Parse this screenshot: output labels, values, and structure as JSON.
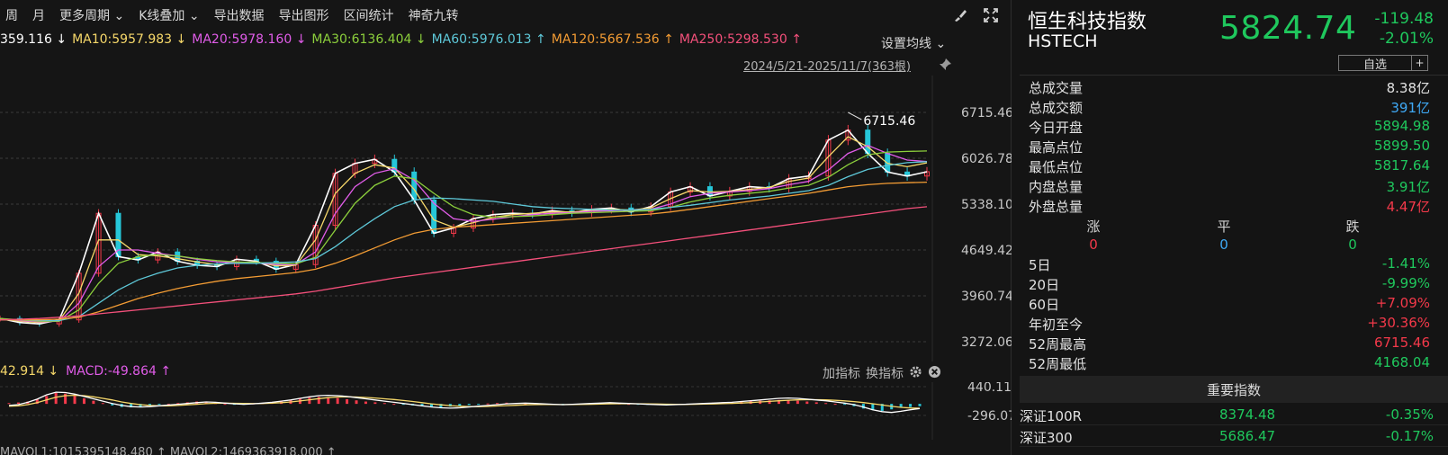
{
  "toolbar": {
    "items": [
      "周",
      "月",
      "更多周期 ⌄",
      "K线叠加 ⌄",
      "导出数据",
      "导出图形",
      "区间统计",
      "神奇九转"
    ]
  },
  "ma_legend": [
    {
      "text": "359.116 ↓",
      "color": "#ffffff"
    },
    {
      "text": "MA10:5957.983 ↓",
      "color": "#f6d86a"
    },
    {
      "text": "MA20:5978.160 ↓",
      "color": "#e05ce8"
    },
    {
      "text": "MA30:6136.404 ↓",
      "color": "#8ccf3c"
    },
    {
      "text": "MA60:5976.013 ↑",
      "color": "#5ec8d8"
    },
    {
      "text": "MA120:5667.536 ↑",
      "color": "#f39c34"
    },
    {
      "text": "MA250:5298.530 ↑",
      "color": "#f4507b"
    }
  ],
  "ma_setting_label": "设置均线 ⌄",
  "date_range": "2024/5/21-2025/11/7(363根)",
  "macd_legend": [
    {
      "text": "42.914 ↓",
      "color": "#f6d86a"
    },
    {
      "text": "MACD:-49.864 ↑",
      "color": "#e05ce8"
    }
  ],
  "indicator_buttons": {
    "add": "加指标",
    "switch": "换指标"
  },
  "chart_data": [
    {
      "type": "line",
      "title": "",
      "y_ticks": [
        "6715.46",
        "6026.78",
        "5338.10",
        "4649.42",
        "3960.74",
        "3272.06"
      ],
      "ylim": [
        3200,
        6800
      ],
      "peak_annotation": "6715.46",
      "grid": true,
      "series": [
        {
          "name": "",
          "color": "#ffffff",
          "values": [
            3620,
            3560,
            3540,
            3600,
            4300,
            5200,
            4550,
            4500,
            4620,
            4480,
            4420,
            4400,
            4510,
            4480,
            4360,
            4430,
            5020,
            5800,
            5950,
            6010,
            5820,
            5400,
            4900,
            4980,
            5120,
            5180,
            5200,
            5190,
            5240,
            5210,
            5260,
            5280,
            5220,
            5300,
            5520,
            5600,
            5460,
            5530,
            5600,
            5580,
            5720,
            5760,
            6300,
            6450,
            6100,
            5820,
            5760,
            5824.74
          ]
        },
        {
          "name": "",
          "color": "#f6d86a",
          "values": [
            3620,
            3580,
            3560,
            3590,
            4000,
            4800,
            4800,
            4580,
            4560,
            4520,
            4470,
            4430,
            4460,
            4470,
            4410,
            4420,
            4800,
            5500,
            5800,
            5930,
            5880,
            5560,
            5100,
            4990,
            5060,
            5140,
            5180,
            5200,
            5220,
            5220,
            5240,
            5260,
            5250,
            5280,
            5420,
            5540,
            5520,
            5530,
            5560,
            5590,
            5680,
            5730,
            6050,
            6350,
            6200,
            5950,
            5900,
            5957.98
          ]
        },
        {
          "name": "",
          "color": "#e05ce8",
          "values": [
            3620,
            3590,
            3570,
            3580,
            3850,
            4400,
            4650,
            4650,
            4600,
            4560,
            4510,
            4470,
            4460,
            4460,
            4430,
            4430,
            4620,
            5200,
            5600,
            5800,
            5870,
            5700,
            5350,
            5120,
            5080,
            5110,
            5150,
            5180,
            5200,
            5210,
            5230,
            5240,
            5250,
            5260,
            5340,
            5450,
            5500,
            5520,
            5540,
            5570,
            5630,
            5680,
            5850,
            6100,
            6220,
            6100,
            6000,
            5978.16
          ]
        },
        {
          "name": "",
          "color": "#8ccf3c",
          "values": [
            3620,
            3600,
            3580,
            3580,
            3750,
            4150,
            4450,
            4550,
            4580,
            4560,
            4520,
            4490,
            4470,
            4460,
            4450,
            4440,
            4540,
            4950,
            5350,
            5620,
            5760,
            5720,
            5500,
            5300,
            5180,
            5140,
            5150,
            5160,
            5180,
            5200,
            5210,
            5220,
            5230,
            5240,
            5290,
            5370,
            5430,
            5470,
            5500,
            5530,
            5580,
            5620,
            5740,
            5930,
            6080,
            6120,
            6130,
            6136.4
          ]
        },
        {
          "name": "",
          "color": "#5ec8d8",
          "values": [
            3600,
            3600,
            3590,
            3590,
            3650,
            3850,
            4050,
            4200,
            4300,
            4380,
            4420,
            4440,
            4450,
            4450,
            4460,
            4470,
            4520,
            4700,
            4920,
            5120,
            5300,
            5400,
            5430,
            5420,
            5400,
            5380,
            5340,
            5300,
            5280,
            5270,
            5260,
            5250,
            5250,
            5260,
            5290,
            5320,
            5360,
            5400,
            5430,
            5460,
            5500,
            5540,
            5620,
            5750,
            5860,
            5920,
            5960,
            5976.01
          ]
        },
        {
          "name": "",
          "color": "#f39c34",
          "values": [
            3600,
            3600,
            3600,
            3610,
            3640,
            3720,
            3820,
            3920,
            4000,
            4070,
            4130,
            4180,
            4220,
            4250,
            4280,
            4310,
            4360,
            4450,
            4560,
            4680,
            4800,
            4900,
            4960,
            4990,
            5010,
            5030,
            5050,
            5070,
            5090,
            5110,
            5130,
            5150,
            5170,
            5190,
            5220,
            5260,
            5300,
            5340,
            5380,
            5420,
            5460,
            5500,
            5550,
            5600,
            5630,
            5650,
            5660,
            5667.54
          ]
        },
        {
          "name": "",
          "color": "#f4507b",
          "values": [
            3600,
            3610,
            3620,
            3640,
            3660,
            3690,
            3720,
            3750,
            3780,
            3810,
            3840,
            3870,
            3900,
            3930,
            3960,
            3990,
            4030,
            4080,
            4130,
            4180,
            4230,
            4270,
            4310,
            4350,
            4390,
            4430,
            4470,
            4510,
            4550,
            4590,
            4630,
            4670,
            4710,
            4750,
            4790,
            4830,
            4870,
            4910,
            4950,
            4990,
            5030,
            5070,
            5110,
            5150,
            5190,
            5230,
            5270,
            5298.53
          ]
        }
      ]
    },
    {
      "type": "bar",
      "title": "",
      "y_ticks": [
        "440.11",
        "-296.07"
      ],
      "ylim": [
        -380,
        500
      ],
      "macd_values": [
        20,
        35,
        60,
        120,
        200,
        280,
        260,
        200,
        140,
        80,
        20,
        -40,
        -80,
        -90,
        -70,
        -40,
        -20,
        0,
        20,
        40,
        60,
        40,
        20,
        0,
        -10,
        -5,
        10,
        20,
        40,
        60,
        90,
        130,
        160,
        180,
        170,
        150,
        120,
        90,
        60,
        40,
        20,
        0,
        -20,
        -40,
        -60,
        -80,
        -90,
        -70,
        -50,
        -30,
        -10,
        10,
        20,
        30,
        20,
        10,
        0,
        -10,
        -20,
        -10,
        0,
        10,
        20,
        30,
        20,
        10,
        0,
        -10,
        -20,
        -30,
        -20,
        -10,
        0,
        10,
        20,
        30,
        40,
        50,
        60,
        70,
        80,
        90,
        100,
        90,
        80,
        60,
        40,
        20,
        0,
        -20,
        -60,
        -120,
        -160,
        -180,
        -140,
        -100,
        -80,
        -60
      ],
      "dif": [
        -40,
        -20,
        40,
        120,
        230,
        300,
        290,
        250,
        190,
        130,
        70,
        10,
        -40,
        -70,
        -80,
        -70,
        -50,
        -30,
        -10,
        10,
        30,
        50,
        40,
        20,
        0,
        -10,
        0,
        20,
        40,
        70,
        100,
        140,
        180,
        210,
        220,
        210,
        190,
        160,
        130,
        100,
        70,
        40,
        10,
        -20,
        -50,
        -80,
        -100,
        -110,
        -100,
        -80,
        -60,
        -40,
        -20,
        0,
        10,
        20,
        10,
        0,
        -10,
        -20,
        -10,
        0,
        10,
        20,
        30,
        20,
        10,
        0,
        -10,
        -20,
        -30,
        -20,
        -10,
        0,
        10,
        20,
        30,
        40,
        60,
        80,
        100,
        120,
        140,
        150,
        140,
        120,
        100,
        80,
        50,
        20,
        -20,
        -80,
        -150,
        -200,
        -220,
        -190,
        -150,
        -120
      ],
      "dea": [
        -60,
        -50,
        -20,
        30,
        100,
        170,
        210,
        220,
        210,
        180,
        140,
        100,
        50,
        10,
        -20,
        -40,
        -50,
        -50,
        -40,
        -25,
        -10,
        5,
        15,
        20,
        15,
        10,
        8,
        10,
        18,
        30,
        50,
        75,
        105,
        135,
        160,
        175,
        180,
        175,
        165,
        150,
        130,
        110,
        85,
        60,
        30,
        0,
        -25,
        -45,
        -60,
        -70,
        -70,
        -65,
        -55,
        -45,
        -35,
        -25,
        -20,
        -18,
        -18,
        -19,
        -17,
        -14,
        -10,
        -5,
        0,
        3,
        4,
        3,
        0,
        -4,
        -9,
        -12,
        -12,
        -10,
        -6,
        -1,
        5,
        12,
        22,
        34,
        48,
        63,
        79,
        93,
        103,
        107,
        106,
        101,
        91,
        77,
        58,
        33,
        3,
        -30,
        -63,
        -90,
        -106,
        -113
      ]
    }
  ],
  "volume_row": "MAVOL1:1015395148.480  ↑    MAVOL2:1469363918.000  ↑",
  "side": {
    "name": "恒生科技指数",
    "code": "HSTECH",
    "last_price": "5824.74",
    "change": "-119.48",
    "change_pct": "-2.01%",
    "watch_label": "自选",
    "watch_plus": "+",
    "stats": [
      {
        "label": "总成交量",
        "value": "8.38亿",
        "color": "white"
      },
      {
        "label": "总成交额",
        "value": "391亿",
        "color": "blue"
      },
      {
        "label": "今日开盘",
        "value": "5894.98",
        "color": "green"
      },
      {
        "label": "最高点位",
        "value": "5899.50",
        "color": "green"
      },
      {
        "label": "最低点位",
        "value": "5817.64",
        "color": "green"
      },
      {
        "label": "内盘总量",
        "value": "3.91亿",
        "color": "green"
      },
      {
        "label": "外盘总量",
        "value": "4.47亿",
        "color": "red"
      }
    ],
    "breadth": {
      "up_label": "涨",
      "flat_label": "平",
      "down_label": "跌",
      "up": "0",
      "flat": "0",
      "down": "0"
    },
    "periods": [
      {
        "label": "5日",
        "value": "-1.41%",
        "color": "green"
      },
      {
        "label": "20日",
        "value": "-9.99%",
        "color": "green"
      },
      {
        "label": "60日",
        "value": "+7.09%",
        "color": "red"
      },
      {
        "label": "年初至今",
        "value": "+30.36%",
        "color": "red"
      },
      {
        "label": "52周最高",
        "value": "6715.46",
        "color": "red"
      },
      {
        "label": "52周最低",
        "value": "4168.04",
        "color": "green"
      }
    ],
    "index_header": "重要指数",
    "indices": [
      {
        "name": "深证100R",
        "price": "8374.48",
        "pct": "-0.35%"
      },
      {
        "name": "深证300",
        "price": "5686.47",
        "pct": "-0.17%"
      }
    ]
  }
}
